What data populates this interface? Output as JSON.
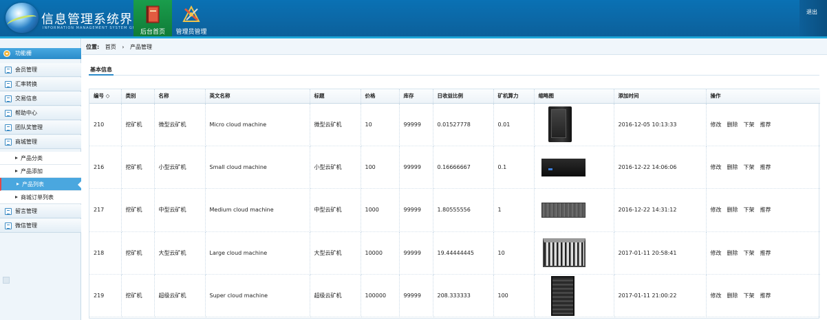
{
  "header": {
    "title": "信息管理系统界面",
    "subtitle": "INFORMATION MANAGEMENT SYSTEM GUI",
    "nav": [
      {
        "label": "后台首页",
        "icon": "book-icon",
        "active": true
      },
      {
        "label": "管理员管理",
        "icon": "tools-icon",
        "active": false
      }
    ],
    "logout_label": "退出",
    "colors": {
      "header_blue": "#0a71b4",
      "active_green": "#1a9d4c"
    }
  },
  "sidebar": {
    "title": "功能栅",
    "items": [
      {
        "label": "会员管理"
      },
      {
        "label": "汇率转换"
      },
      {
        "label": "交易信息"
      },
      {
        "label": "帮助中心"
      },
      {
        "label": "团队奖管理"
      },
      {
        "label": "商城管理"
      }
    ],
    "subitems": [
      {
        "label": "产品分类"
      },
      {
        "label": "产品添加"
      },
      {
        "label": "产品列表",
        "active": true
      },
      {
        "label": "商城订单列表"
      }
    ],
    "items_after": [
      {
        "label": "留言管理"
      },
      {
        "label": "微信管理"
      }
    ]
  },
  "breadcrumb": {
    "prefix": "位置:",
    "home": "首页",
    "sep": "›",
    "current": "产品管理"
  },
  "section_title": "基本信息",
  "table": {
    "columns": [
      "编号 ◇",
      "类别",
      "名称",
      "英文名称",
      "标题",
      "价格",
      "库存",
      "日收益比例",
      "矿机算力",
      "缩略图",
      "添加时间",
      "操作"
    ],
    "rows": [
      {
        "id": "210",
        "category": "挖矿机",
        "name": "微型云矿机",
        "english": "Micro cloud machine",
        "title": "微型云矿机",
        "price": "10",
        "stock": "99999",
        "ratio": "0.01527778",
        "power": "0.01",
        "thumb": "tower",
        "time": "2016-12-05 10:13:33"
      },
      {
        "id": "216",
        "category": "挖矿机",
        "name": "小型云矿机",
        "english": "Small cloud machine",
        "title": "小型云矿机",
        "price": "100",
        "stock": "99999",
        "ratio": "0.16666667",
        "power": "0.1",
        "thumb": "box",
        "time": "2016-12-22 14:06:06"
      },
      {
        "id": "217",
        "category": "挖矿机",
        "name": "中型云矿机",
        "english": "Medium cloud machine",
        "title": "中型云矿机",
        "price": "1000",
        "stock": "99999",
        "ratio": "1.80555556",
        "power": "1",
        "thumb": "rack",
        "time": "2016-12-22 14:31:12"
      },
      {
        "id": "218",
        "category": "挖矿机",
        "name": "大型云矿机",
        "english": "Large cloud machine",
        "title": "大型云矿机",
        "price": "10000",
        "stock": "99999",
        "ratio": "19.44444445",
        "power": "10",
        "thumb": "large",
        "time": "2017-01-11 20:58:41"
      },
      {
        "id": "219",
        "category": "挖矿机",
        "name": "超级云矿机",
        "english": "Super cloud machine",
        "title": "超级云矿机",
        "price": "100000",
        "stock": "99999",
        "ratio": "208.333333",
        "power": "100",
        "thumb": "cabinet",
        "time": "2017-01-11 21:00:22"
      }
    ],
    "actions": [
      "修改",
      "删除",
      "下架",
      "推荐"
    ]
  }
}
